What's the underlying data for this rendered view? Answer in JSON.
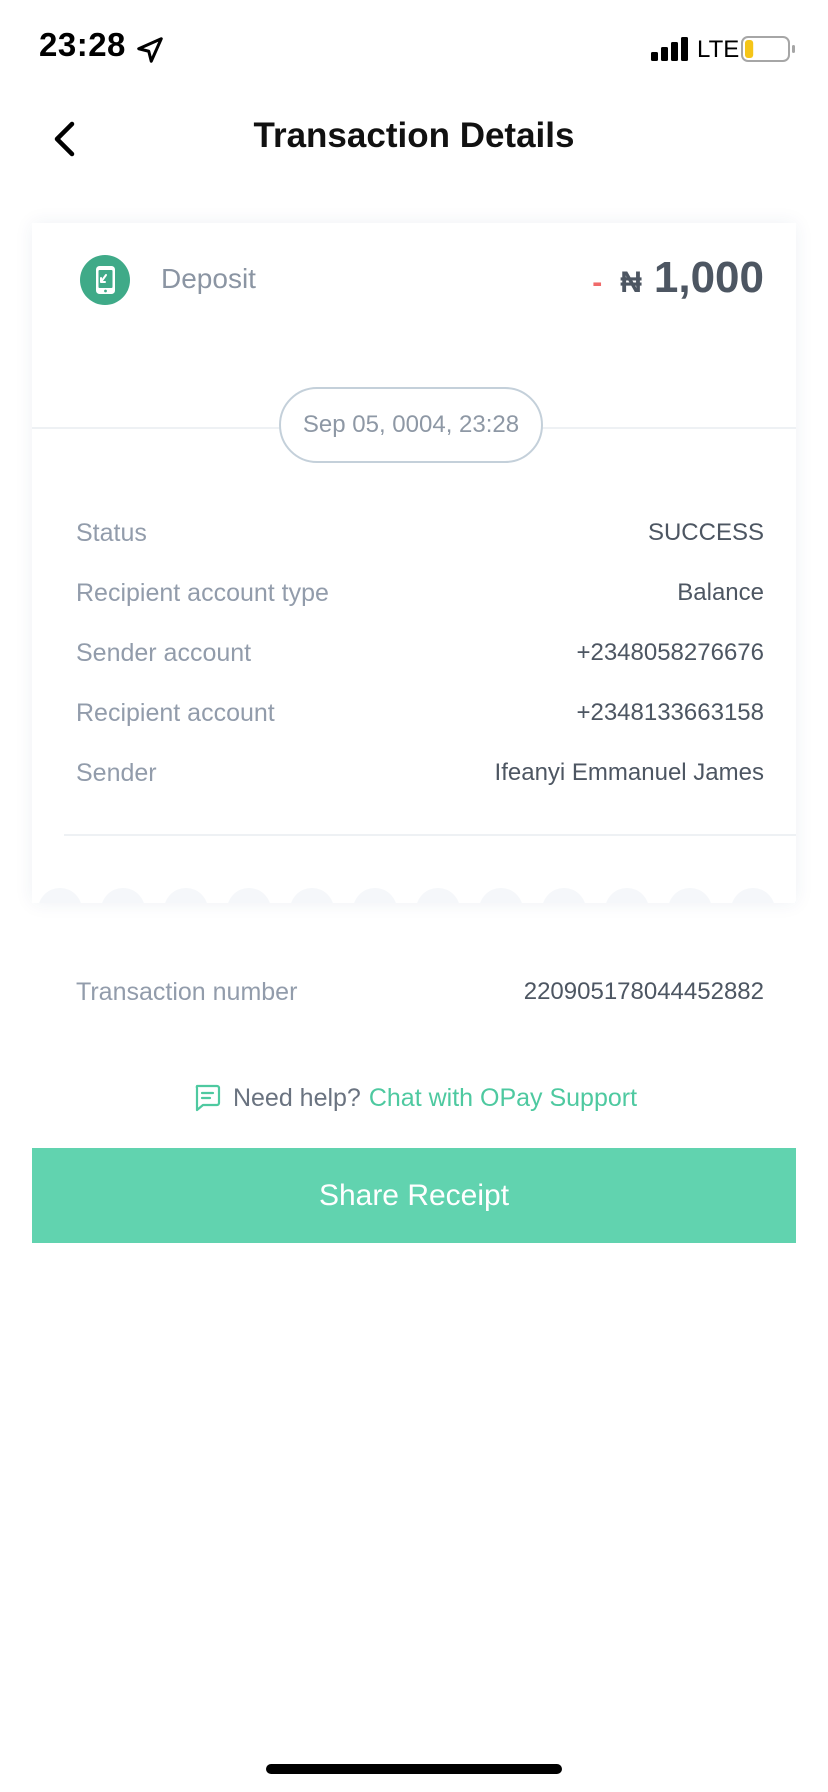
{
  "status_bar": {
    "time": "23:28",
    "network": "LTE",
    "location_icon": "location-arrow-icon",
    "signal_icon": "cellular-signal-icon",
    "battery_icon": "battery-icon",
    "battery_level": 0.2,
    "battery_color": "#f5c518"
  },
  "header": {
    "title": "Transaction Details",
    "back_icon": "chevron-left-icon"
  },
  "transaction": {
    "type_label": "Deposit",
    "type_icon": "phone-deposit-icon",
    "type_icon_color": "#3faa88",
    "amount_sign": "-",
    "currency": "₦",
    "amount": "1,000",
    "datetime": "Sep 05, 0004, 23:28",
    "details": [
      {
        "label": "Status",
        "value": "SUCCESS"
      },
      {
        "label": "Recipient account type",
        "value": "Balance"
      },
      {
        "label": "Sender account",
        "value": "+2348058276676"
      },
      {
        "label": "Recipient account",
        "value": "+2348133663158"
      },
      {
        "label": "Sender",
        "value": "Ifeanyi Emmanuel James"
      }
    ],
    "transaction_number_label": "Transaction number",
    "transaction_number": "220905178044452882"
  },
  "help": {
    "icon": "chat-icon",
    "prefix": "Need help?",
    "link": "Chat with OPay Support"
  },
  "actions": {
    "share_label": "Share Receipt"
  },
  "colors": {
    "accent": "#61d3af",
    "link": "#4ec9a0",
    "negative": "#f06a6a"
  }
}
